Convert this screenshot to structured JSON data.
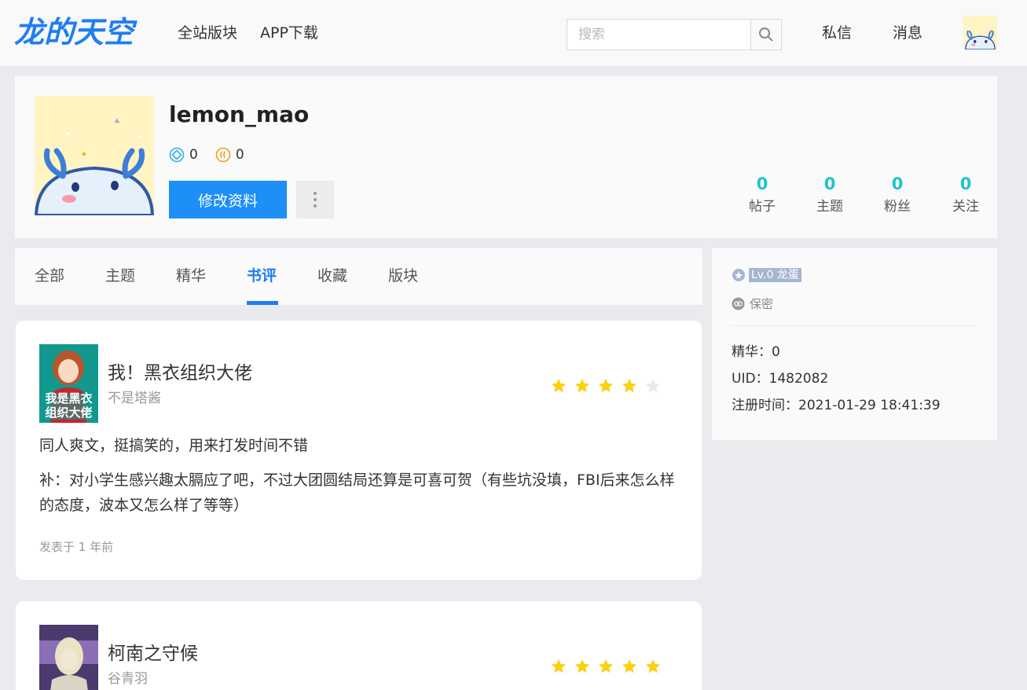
{
  "header": {
    "logo": "龙的天空",
    "nav": [
      "全站版块",
      "APP下载"
    ],
    "search_placeholder": "搜索",
    "messages_label": "私信",
    "notifications_label": "消息"
  },
  "profile": {
    "username": "lemon_mao",
    "coin_a": "0",
    "coin_b": "0",
    "edit_button": "修改资料",
    "stats": [
      {
        "value": "0",
        "label": "帖子"
      },
      {
        "value": "0",
        "label": "主题"
      },
      {
        "value": "0",
        "label": "粉丝"
      },
      {
        "value": "0",
        "label": "关注"
      }
    ]
  },
  "tabs": [
    "全部",
    "主题",
    "精华",
    "书评",
    "收藏",
    "版块"
  ],
  "active_tab": "书评",
  "sidebar": {
    "level": "Lv.0 龙蛋",
    "privacy": "保密",
    "elite": "精华：0",
    "uid": "UID：1482082",
    "registered": "注册时间：2021-01-29 18:41:39"
  },
  "reviews": [
    {
      "title": "我！黑衣组织大佬",
      "author": "不是塔酱",
      "rating": 4,
      "paragraphs": [
        "同人爽文，挺搞笑的，用来打发时间不错",
        "补：对小学生感兴趣太膈应了吧，不过大团圆结局还算是可喜可贺（有些坑没填，FBI后来怎么样的态度，波本又怎么样了等等）"
      ],
      "time": "发表于 1 年前",
      "cover_text": "我是黑衣组织大佬"
    },
    {
      "title": "柯南之守候",
      "author": "谷青羽",
      "rating": 5
    }
  ],
  "colors": {
    "accent": "#1e7df1",
    "stat": "#1ec3cc",
    "star": "#fdd010",
    "star_empty": "#e8e8ea"
  }
}
